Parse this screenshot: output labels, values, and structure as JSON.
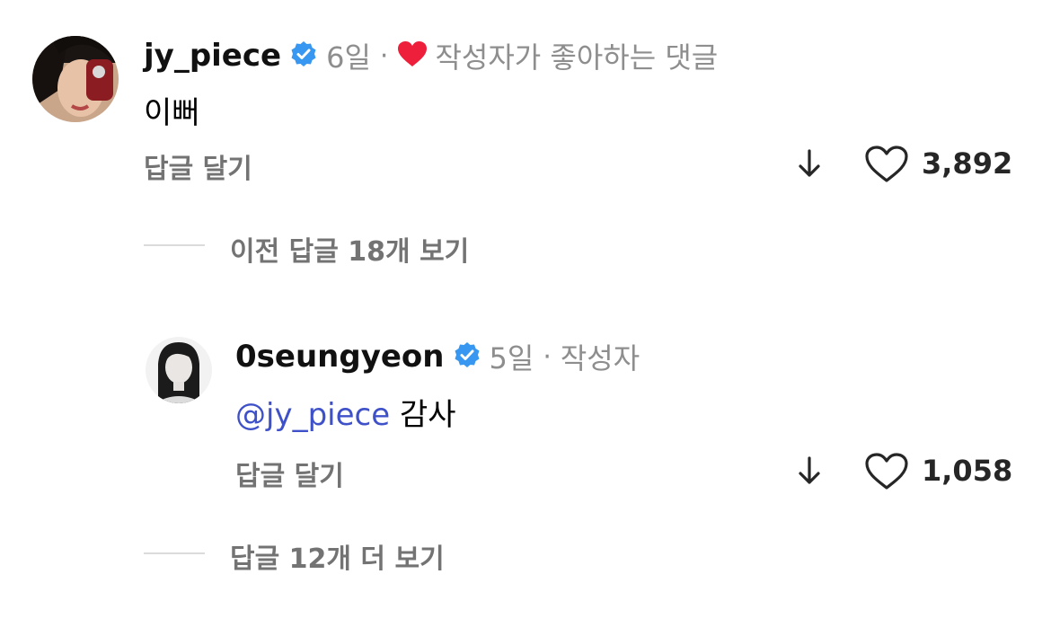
{
  "colors": {
    "verified": "#3897f0",
    "heart_liked": "#ed1f3a",
    "mention": "#3f51c8",
    "secondary_text": "#8e8e8e"
  },
  "comment": {
    "username": "jy_piece",
    "time": "6일",
    "separator": "·",
    "creator_liked_label": "작성자가 좋아하는 댓글",
    "text": "이뻐",
    "reply_label": "답글 달기",
    "like_count": "3,892"
  },
  "view_previous_replies": "이전 답글 18개 보기",
  "reply": {
    "username": "0seungyeon",
    "time": "5일",
    "separator": "·",
    "author_label": "작성자",
    "mention": "@jy_piece",
    "text": "감사",
    "reply_label": "답글 달기",
    "like_count": "1,058"
  },
  "view_more_replies": "답글 12개 더 보기"
}
